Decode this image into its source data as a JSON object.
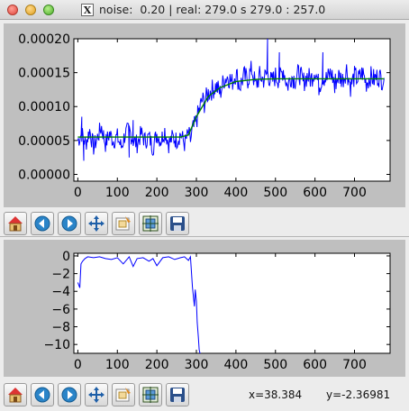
{
  "window": {
    "title": "noise:  0.20 | real: 279.0 s 279.0 : 257.0",
    "x11_glyph": "X"
  },
  "toolbar_icons": [
    "home-icon",
    "back-icon",
    "forward-icon",
    "pan-icon",
    "zoom-icon",
    "subplots-icon",
    "save-icon"
  ],
  "status": {
    "x": "x=38.384",
    "y": "y=-2.36981"
  },
  "chart_data": [
    {
      "type": "line",
      "xlim": [
        -10,
        790
      ],
      "ylim": [
        -1e-05,
        0.0002
      ],
      "xticks": [
        "0",
        "100",
        "200",
        "300",
        "400",
        "500",
        "600",
        "700"
      ],
      "xtick_values": [
        0,
        100,
        200,
        300,
        400,
        500,
        600,
        700
      ],
      "yticks": [
        "0.00000",
        "0.00005",
        "0.00010",
        "0.00015",
        "0.00020"
      ],
      "ytick_values": [
        0,
        5e-05,
        0.0001,
        0.00015,
        0.0002
      ],
      "grid": false,
      "series": [
        {
          "style": "noisy-blue",
          "color": "#0000ff",
          "x": [
            0,
            10,
            20,
            30,
            40,
            50,
            60,
            70,
            80,
            90,
            100,
            110,
            120,
            130,
            140,
            150,
            160,
            170,
            180,
            190,
            200,
            210,
            220,
            230,
            240,
            250,
            260,
            270,
            280,
            285,
            290,
            295,
            300,
            305,
            310,
            315,
            320,
            330,
            340,
            350,
            360,
            370,
            380,
            390,
            400,
            410,
            420,
            430,
            440,
            450,
            460,
            470,
            480,
            490,
            500,
            510,
            520,
            530,
            540,
            550,
            560,
            570,
            580,
            590,
            600,
            610,
            620,
            630,
            640,
            650,
            660,
            670,
            680,
            690,
            700,
            710,
            720,
            730,
            740,
            750,
            760,
            770,
            775
          ],
          "y": [
            5e-05,
            6e-05,
            4.5e-05,
            6.5e-05,
            4e-05,
            5.5e-05,
            7e-05,
            4.5e-05,
            6e-05,
            5e-05,
            5.5e-05,
            4e-05,
            6e-05,
            6.5e-05,
            5e-05,
            4.5e-05,
            6e-05,
            5e-05,
            5.5e-05,
            4e-05,
            6e-05,
            5e-05,
            6.5e-05,
            4.5e-05,
            5.5e-05,
            5e-05,
            6e-05,
            4.5e-05,
            6e-05,
            5e-05,
            6.5e-05,
            7e-05,
            8e-05,
            9e-05,
            0.0001,
            0.00011,
            0.000105,
            0.00012,
            0.000125,
            0.00013,
            0.00012,
            0.00014,
            0.000145,
            0.000135,
            0.00015,
            0.00013,
            0.000145,
            0.00014,
            0.000155,
            0.00013,
            0.000145,
            0.00014,
            0.00015,
            0.000135,
            0.000145,
            0.00014,
            0.000155,
            0.00013,
            0.000145,
            0.00014,
            0.00015,
            0.000135,
            0.000145,
            0.00014,
            0.000155,
            0.00013,
            0.000145,
            0.00014,
            0.00015,
            0.000135,
            0.000145,
            0.00014,
            0.000155,
            0.00013,
            0.000145,
            0.00014,
            0.00015,
            0.000135,
            0.000145,
            0.00014,
            0.000145,
            0.00014,
            0.000142
          ],
          "outliers": [
            [
              10,
              8.5e-05
            ],
            [
              15,
              2e-05
            ],
            [
              140,
              8e-05
            ],
            [
              130,
              2.5e-05
            ],
            [
              480,
              0.0002
            ],
            [
              510,
              0.00018
            ],
            [
              620,
              0.00018
            ],
            [
              650,
              0.00012
            ]
          ]
        },
        {
          "style": "smooth-fit",
          "color": "#008000",
          "x": [
            0,
            260,
            280,
            300,
            330,
            360,
            400,
            450,
            500,
            600,
            700,
            775
          ],
          "y": [
            5.5e-05,
            5.5e-05,
            5.8e-05,
            8.5e-05,
            0.000115,
            0.000128,
            0.000137,
            0.00014,
            0.000141,
            0.000141,
            0.000141,
            0.000141
          ]
        }
      ]
    },
    {
      "type": "line",
      "xlim": [
        -10,
        790
      ],
      "ylim": [
        -11,
        0.3
      ],
      "xticks": [
        "0",
        "100",
        "200",
        "300",
        "400",
        "500",
        "600",
        "700"
      ],
      "xtick_values": [
        0,
        100,
        200,
        300,
        400,
        500,
        600,
        700
      ],
      "yticks": [
        "0",
        "−2",
        "−4",
        "−6",
        "−8",
        "−10"
      ],
      "ytick_values": [
        0,
        -2,
        -4,
        -6,
        -8,
        -10
      ],
      "grid": false,
      "series": [
        {
          "color": "#0000ff",
          "x": [
            0,
            5,
            8,
            12,
            18,
            25,
            40,
            55,
            70,
            85,
            100,
            115,
            130,
            140,
            150,
            165,
            180,
            190,
            200,
            215,
            230,
            245,
            260,
            270,
            280,
            285,
            290,
            295,
            297,
            300,
            302,
            305,
            307,
            309,
            311
          ],
          "y": [
            -3,
            -3.6,
            -0.9,
            -0.6,
            -0.3,
            -0.1,
            -0.2,
            -0.1,
            -0.3,
            -0.4,
            -0.2,
            -0.9,
            -0.1,
            -1.2,
            -0.3,
            -0.2,
            -0.6,
            -0.3,
            -1.1,
            -0.2,
            -0.1,
            -0.4,
            -0.2,
            -0.1,
            -0.5,
            -0.1,
            -3.5,
            -5.7,
            -3.8,
            -5.1,
            -7.5,
            -9.2,
            -10.6,
            -11,
            -11
          ]
        }
      ]
    }
  ]
}
